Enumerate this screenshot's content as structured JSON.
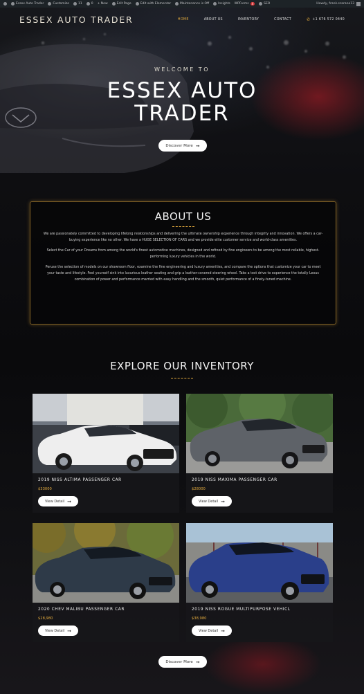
{
  "admin_bar": {
    "items": [
      "Essex Auto Trader",
      "Customize",
      "11",
      "0",
      "+ New",
      "Edit Page",
      "Edit with Elementor",
      "Maintenance is Off",
      "Insights",
      "WPForms",
      "SEO"
    ],
    "wpforms_badge": "4",
    "howdy": "Howdy, frank.scarano13"
  },
  "header": {
    "logo": "ESSEX AUTO TRADER",
    "nav": [
      {
        "label": "HOME",
        "active": true
      },
      {
        "label": "ABOUT US",
        "active": false
      },
      {
        "label": "INVENTORY",
        "active": false
      },
      {
        "label": "CONTACT",
        "active": false
      }
    ],
    "phone": "+1 676 572 0440"
  },
  "hero": {
    "welcome": "WELCOME TO",
    "title_line1": "ESSEX AUTO",
    "title_line2": "TRADER",
    "button": "Discover More"
  },
  "about": {
    "title": "ABOUT US",
    "paragraphs": [
      "We are passionately committed to developing lifelong relationships and delivering the ultimate ownership experience through integrity and innovation. We offers a car-buying experience like no other. We have a HUGE SELECTION OF CARS and we provide elite customer service and world-class amenities.",
      "Select the Car of your Dreams from among the world's finest automotive machines, designed and refined by fine engineers to be among the most reliable, highest-performing luxury vehicles in the world.",
      "Peruse the selection of models on our showroom floor, examine the fine engineering and luxury amenities, and compare the options that customize your car to meet your taste and lifestyle. Feel yourself sink into luxurious leather seating and grip a leather-covered steering wheel. Take a test drive to experience the totally Lexus combination of power and performance married with easy handling and the smooth, quiet performance of a finely-tuned machine."
    ]
  },
  "inventory": {
    "title": "EXPLORE OUR INVENTORY",
    "cards": [
      {
        "name": "2019 NISS ALTIMA PASSENGER CAR",
        "price": "$33000",
        "button": "View Detail"
      },
      {
        "name": "2019 NISS MAXIMA PASSENGER CAR",
        "price": "$28000",
        "button": "View Detail"
      },
      {
        "name": "2020 CHEV MALIBU PASSENGER CAR",
        "price": "$28,980",
        "button": "View Detail"
      },
      {
        "name": "2019 NISS ROGUE MULTIPURPOSE VEHICL",
        "price": "$38,980",
        "button": "View Detail"
      }
    ],
    "bottom_button": "Discover More"
  },
  "colors": {
    "accent": "#e1a93d",
    "admin_bar": "#1d2327",
    "background": "#0b0b0d"
  },
  "icons": {
    "phone": "phone-icon",
    "arrow": "arrow-right-icon"
  }
}
